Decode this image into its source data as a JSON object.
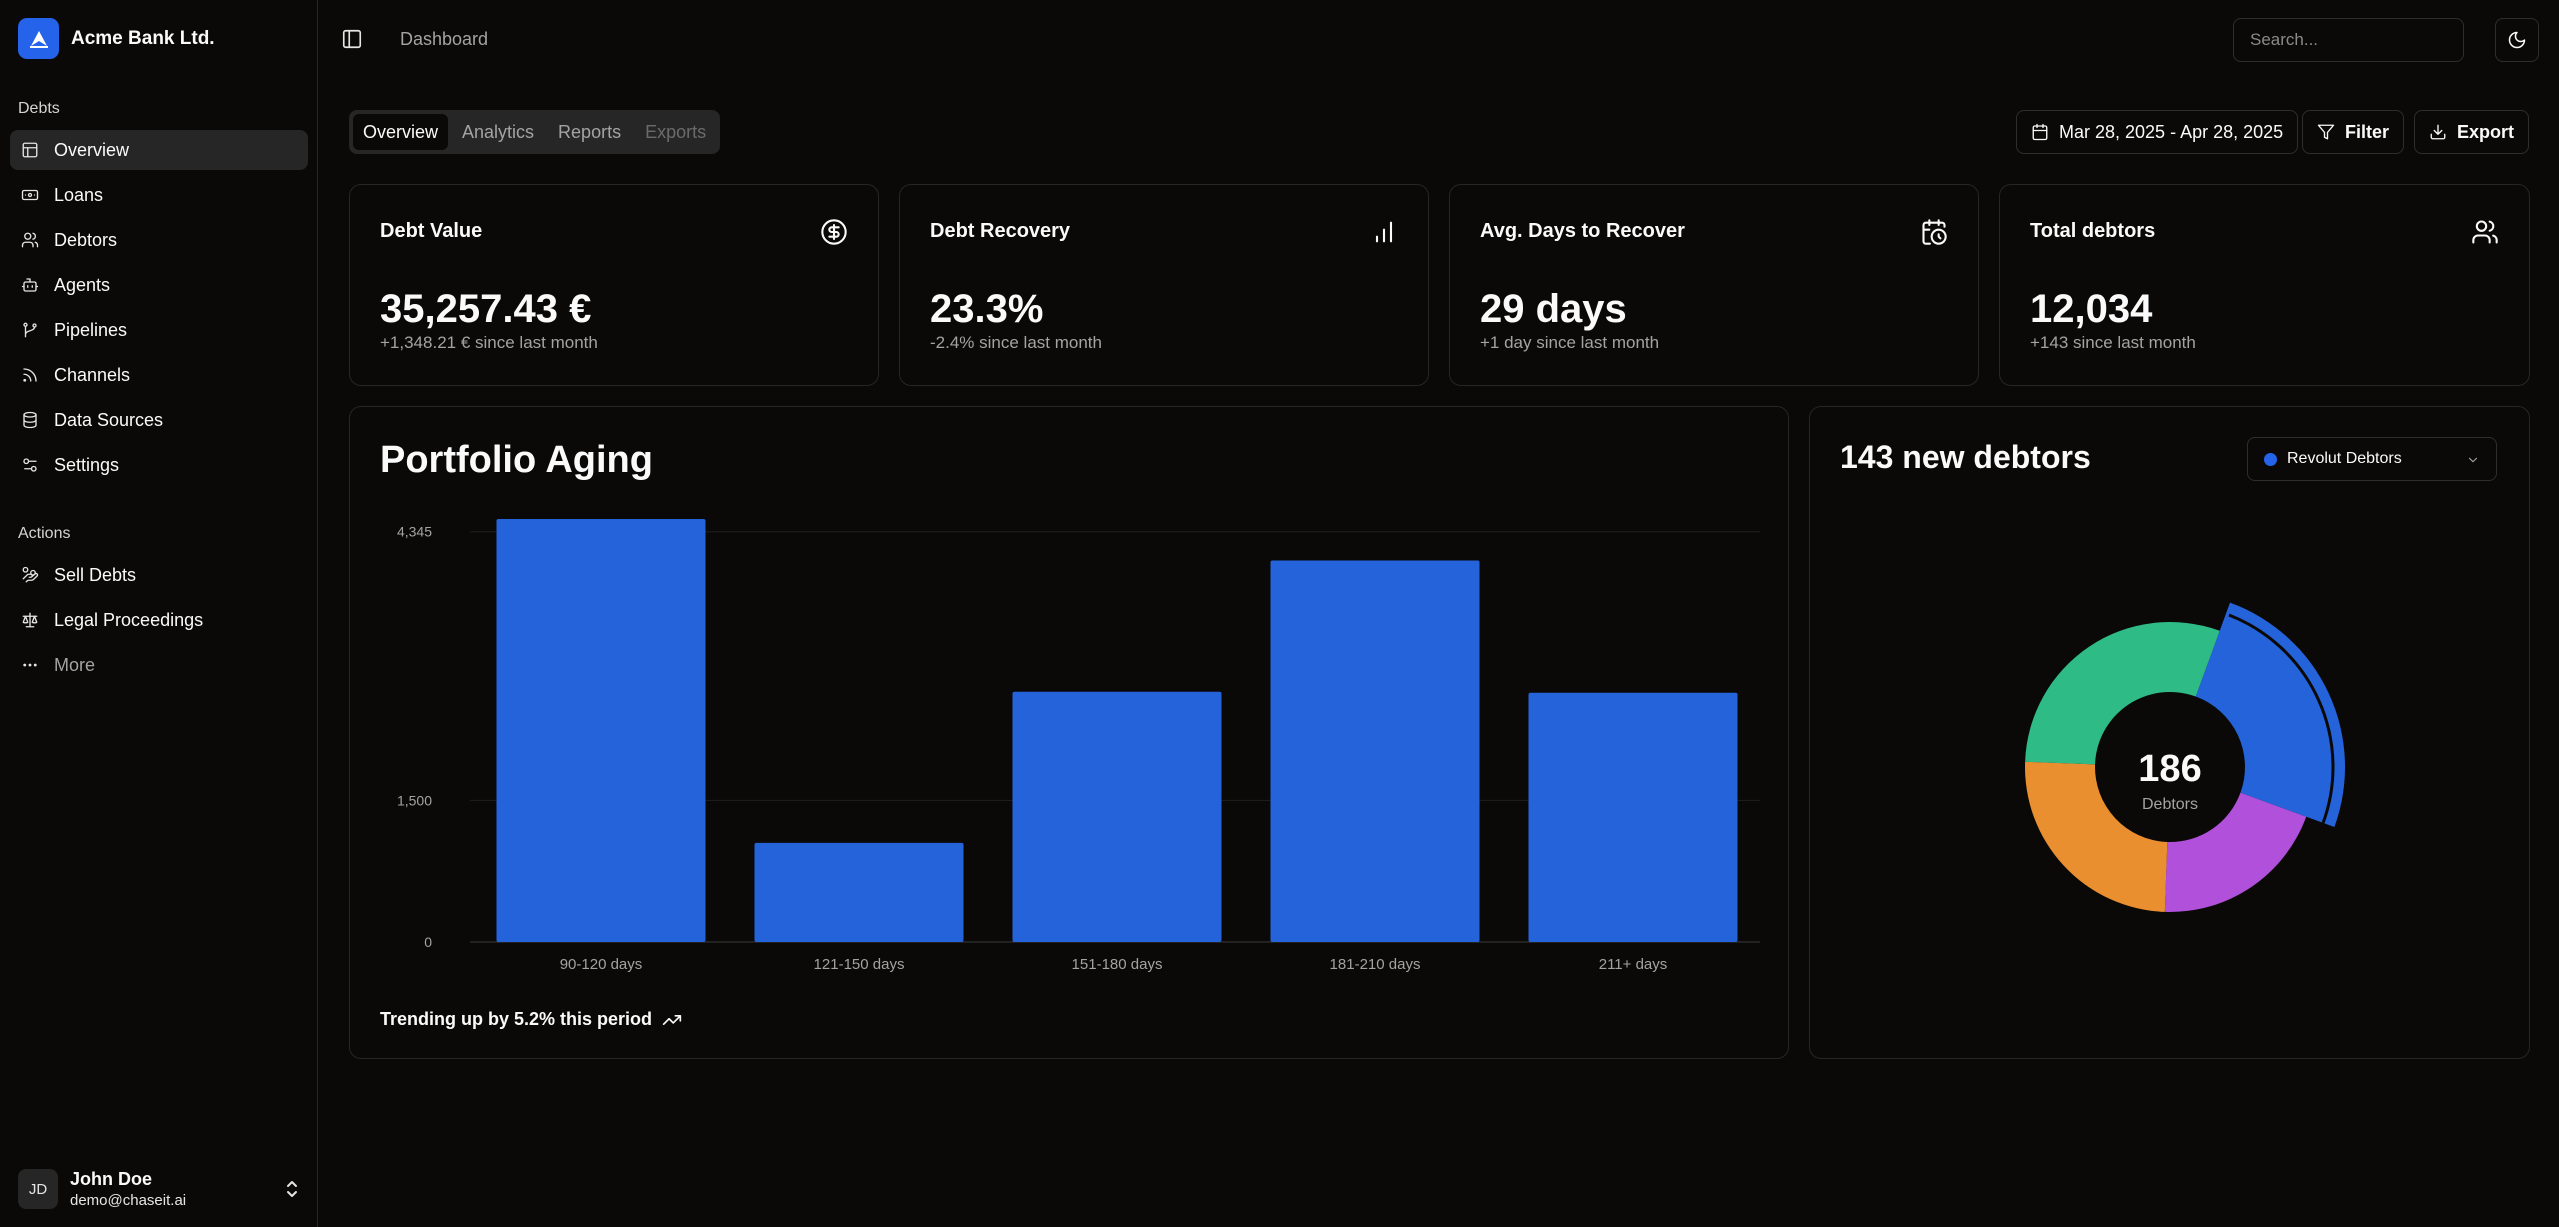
{
  "brand": {
    "name": "Acme Bank Ltd."
  },
  "sidebar": {
    "debts_label": "Debts",
    "debts_items": [
      {
        "label": "Overview",
        "icon": "layout-icon"
      },
      {
        "label": "Loans",
        "icon": "banknote-icon"
      },
      {
        "label": "Debtors",
        "icon": "users-icon"
      },
      {
        "label": "Agents",
        "icon": "bot-icon"
      },
      {
        "label": "Pipelines",
        "icon": "git-branch-icon"
      },
      {
        "label": "Channels",
        "icon": "rss-icon"
      },
      {
        "label": "Data Sources",
        "icon": "database-icon"
      },
      {
        "label": "Settings",
        "icon": "settings-icon"
      }
    ],
    "actions_label": "Actions",
    "actions_items": [
      {
        "label": "Sell Debts",
        "icon": "hand-coins-icon"
      },
      {
        "label": "Legal Proceedings",
        "icon": "scale-icon"
      },
      {
        "label": "More",
        "icon": "more-icon"
      }
    ]
  },
  "user": {
    "initials": "JD",
    "name": "John Doe",
    "email": "demo@chaseit.ai"
  },
  "header": {
    "breadcrumb": "Dashboard",
    "search_placeholder": "Search..."
  },
  "tabs": [
    "Overview",
    "Analytics",
    "Reports",
    "Exports"
  ],
  "toolbar": {
    "date_range": "Mar 28, 2025 - Apr 28, 2025",
    "filter": "Filter",
    "export": "Export"
  },
  "kpis": [
    {
      "title": "Debt Value",
      "value": "35,257.43 €",
      "sub": "+1,348.21 € since last month",
      "icon": "dollar-circle-icon"
    },
    {
      "title": "Debt Recovery",
      "value": "23.3%",
      "sub": "-2.4% since last month",
      "icon": "bar-chart-icon"
    },
    {
      "title": "Avg. Days to Recover",
      "value": "29 days",
      "sub": "+1 day since last month",
      "icon": "calendar-clock-icon"
    },
    {
      "title": "Total debtors",
      "value": "12,034",
      "sub": "+143 since last month",
      "icon": "users-icon"
    }
  ],
  "portfolio": {
    "title": "Portfolio Aging",
    "trend": "Trending up by 5.2% this period"
  },
  "chart_data": [
    {
      "type": "bar",
      "title": "Portfolio Aging",
      "categories": [
        "90-120 days",
        "121-150 days",
        "151-180 days",
        "181-210 days",
        "211+ days"
      ],
      "values": [
        4480,
        1050,
        2650,
        4040,
        2640
      ],
      "yticks": [
        0,
        1500,
        4345
      ],
      "ytick_labels": [
        "0",
        "1,500",
        "4,345"
      ],
      "ylim": [
        0,
        4480
      ],
      "grid": true,
      "color": "#2563db"
    },
    {
      "type": "pie",
      "title": "143 new debtors",
      "center_value": "186",
      "center_label": "Debtors",
      "slices": [
        {
          "value": 25,
          "color": "#2563db",
          "highlighted": true
        },
        {
          "value": 20,
          "color": "#b150db"
        },
        {
          "value": 25,
          "color": "#ea8f30"
        },
        {
          "value": 30,
          "color": "#2ebb86"
        }
      ]
    }
  ],
  "donut": {
    "title": "143 new debtors",
    "select_label": "Revolut Debtors",
    "select_color": "#2563eb"
  }
}
